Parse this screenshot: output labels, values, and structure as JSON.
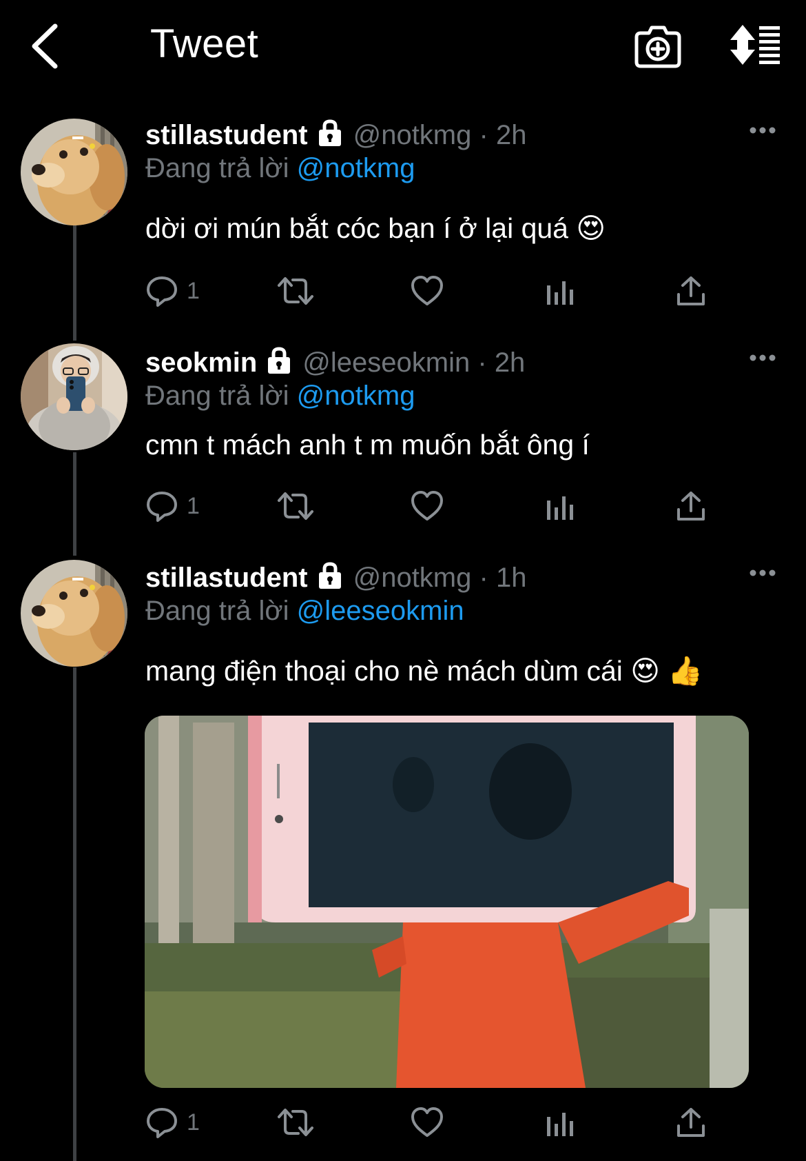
{
  "header": {
    "title": "Tweet"
  },
  "tweets": [
    {
      "display_name": "stillastudent",
      "handle": "@notkmg",
      "separator": "·",
      "time": "2h",
      "reply_prefix": "Đang trả lời",
      "reply_to": "@notkmg",
      "text": "dời ơi mún bắt cóc bạn í ở lại quá 😍",
      "reply_count": "1"
    },
    {
      "display_name": "seokmin",
      "handle": "@leeseokmin",
      "separator": "·",
      "time": "2h",
      "reply_prefix": "Đang trả lời",
      "reply_to": "@notkmg",
      "text": "cmn t mách anh t m muốn bắt ông í",
      "reply_count": "1"
    },
    {
      "display_name": "stillastudent",
      "handle": "@notkmg",
      "separator": "·",
      "time": "1h",
      "reply_prefix": "Đang trả lời",
      "reply_to": "@leeseokmin",
      "text": "mang điện thoại cho nè mách dùm cái 😍 👍",
      "reply_count": "1"
    }
  ],
  "colors": {
    "background": "#000000",
    "text_primary": "#ffffff",
    "text_secondary": "#71767b",
    "link": "#1d9bf0",
    "thread_line": "#3e4144"
  }
}
